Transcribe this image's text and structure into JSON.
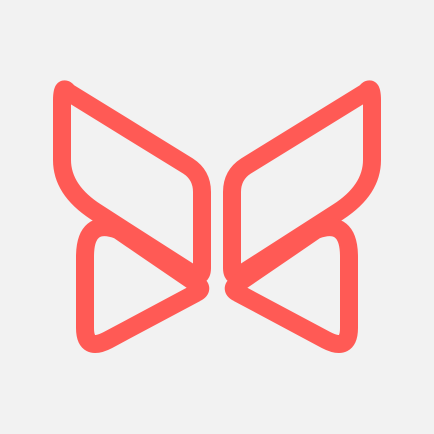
{
  "app_icon": {
    "icon_name": "butterfly-logo-icon",
    "background_color": "#f2f2f2",
    "stroke_color": "#ff5a55"
  }
}
